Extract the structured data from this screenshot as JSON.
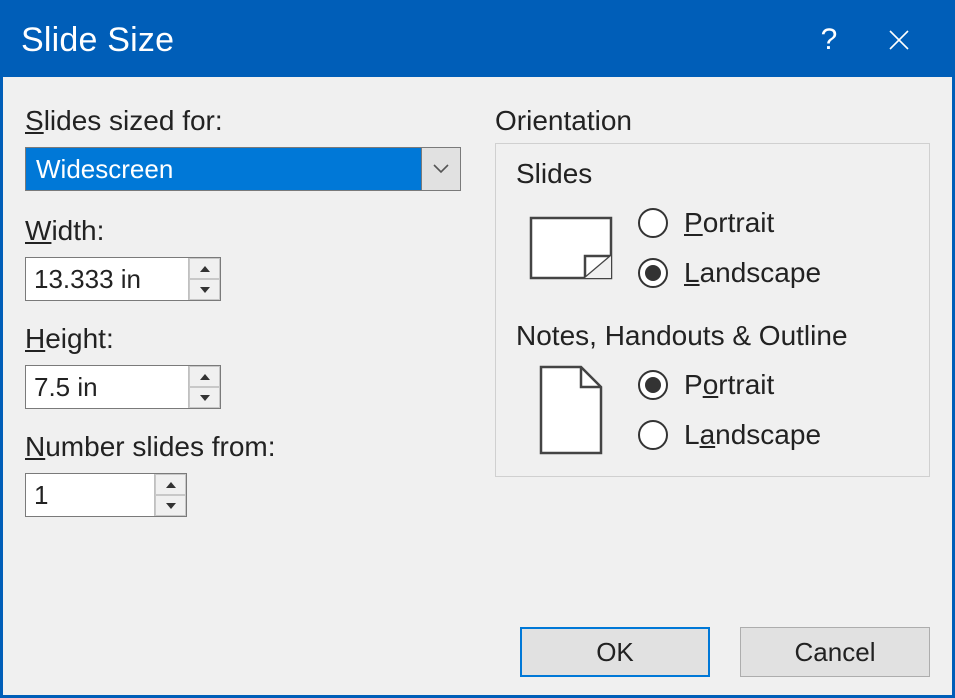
{
  "titlebar": {
    "title": "Slide Size"
  },
  "left": {
    "sized_for_label_pre": "S",
    "sized_for_label_post": "lides sized for:",
    "sized_for_value": "Widescreen",
    "width_label_pre": "W",
    "width_label_post": "idth:",
    "width_value": "13.333 in",
    "height_label_pre": "H",
    "height_label_post": "eight:",
    "height_value": "7.5 in",
    "number_label_pre": "N",
    "number_label_post": "umber slides from:",
    "number_value": "1"
  },
  "right": {
    "orientation_label": "Orientation",
    "slides_label": "Slides",
    "slides_portrait_pre": "P",
    "slides_portrait_post": "ortrait",
    "slides_landscape_pre": "L",
    "slides_landscape_post": "andscape",
    "notes_label": "Notes, Handouts & Outline",
    "notes_portrait_pre": "o",
    "notes_portrait_prefix": "P",
    "notes_portrait_post": "rtrait",
    "notes_landscape_pre": "a",
    "notes_landscape_prefix": "L",
    "notes_landscape_post": "ndscape"
  },
  "footer": {
    "ok": "OK",
    "cancel": "Cancel"
  }
}
